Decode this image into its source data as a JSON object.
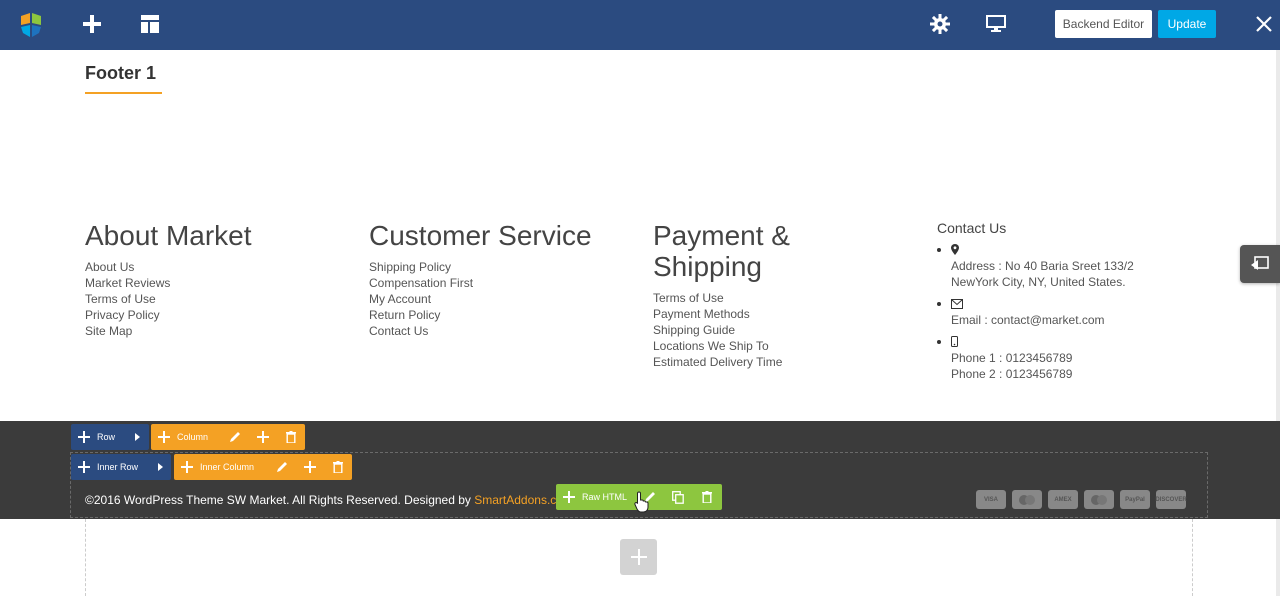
{
  "toolbar": {
    "backend_editor_label": "Backend Editor",
    "update_label": "Update",
    "icons": [
      "builder-logo-icon",
      "add-icon",
      "layout-icon",
      "gear-icon",
      "monitor-icon",
      "close-icon"
    ]
  },
  "page": {
    "title": "Footer 1"
  },
  "columns": [
    {
      "heading": "About Market",
      "links": [
        "About Us",
        "Market Reviews",
        "Terms of Use",
        "Privacy Policy",
        "Site Map"
      ]
    },
    {
      "heading": "Customer Service",
      "links": [
        "Shipping Policy",
        "Compensation First",
        "My Account",
        "Return Policy",
        "Contact Us"
      ]
    },
    {
      "heading_line1": "Payment &",
      "heading_line2": "Shipping",
      "links": [
        "Terms of Use",
        "Payment Methods",
        "Shipping Guide",
        "Locations We Ship To",
        "Estimated Delivery Time"
      ]
    }
  ],
  "contact": {
    "title": "Contact Us",
    "address_line1": "Address : No 40 Baria Sreet 133/2",
    "address_line2": "NewYork City, NY, United States.",
    "email": "Email : contact@market.com",
    "phone1": "Phone 1 : 0123456789",
    "phone2": "Phone 2 : 0123456789"
  },
  "editor_controls": {
    "row": "Row",
    "column": "Column",
    "inner_row": "Inner Row",
    "inner_column": "Inner Column",
    "raw_html": "Raw HTML"
  },
  "footer_bar": {
    "copyright": "©2016 WordPress Theme SW Market. All Rights Reserved. Designed by ",
    "designer": "SmartAddons.com",
    "payments": [
      "VISA",
      "",
      "AMEX",
      "",
      "PayPal",
      "DISCOVER"
    ]
  },
  "colors": {
    "toolbar_bg": "#2b4b80",
    "accent_orange": "#f4a124",
    "update_blue": "#00a8e6",
    "raw_html_green": "#8dc63f",
    "footer_dark": "#3b3b3b"
  }
}
